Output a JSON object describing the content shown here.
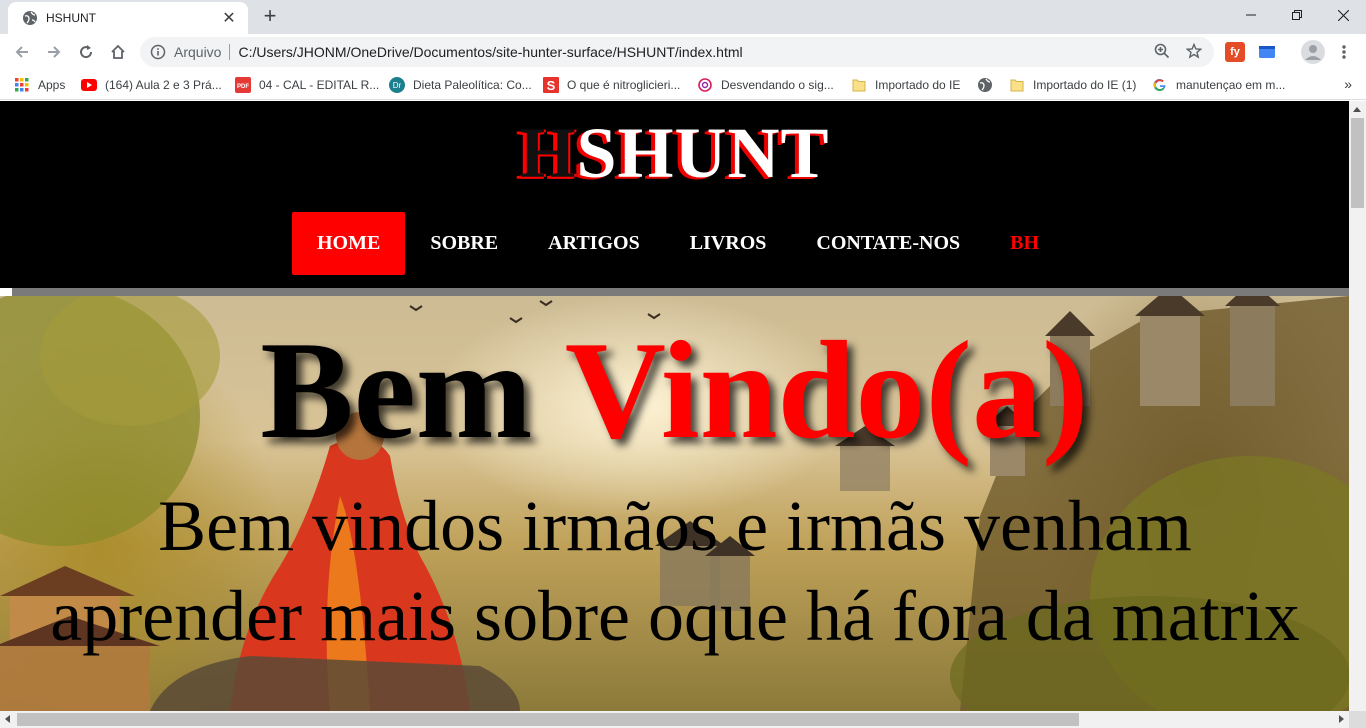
{
  "browser": {
    "tab_title": "HSHUNT",
    "new_tab_symbol": "+",
    "close_symbol": "✕",
    "omnibox_label": "Arquivo",
    "url": "C:/Users/JHONM/OneDrive/Documentos/site-hunter-surface/HSHUNT/index.html",
    "extension_fy_label": "fy",
    "bookmarks": [
      {
        "icon": "apps-grid-icon",
        "label": "Apps"
      },
      {
        "icon": "youtube-icon",
        "label": "(164) Aula 2 e 3 Prá..."
      },
      {
        "icon": "pdf-icon",
        "label": "04 - CAL - EDITAL R..."
      },
      {
        "icon": "dr-site-icon",
        "label": "Dieta Paleolítica: Co..."
      },
      {
        "icon": "s-site-icon",
        "label": "O que é nitroglicieri..."
      },
      {
        "icon": "swirl-site-icon",
        "label": "Desvendando o sig..."
      },
      {
        "icon": "folder-icon",
        "label": "Importado do IE"
      },
      {
        "icon": "globe-icon",
        "label": ""
      },
      {
        "icon": "folder-icon",
        "label": "Importado do IE (1)"
      },
      {
        "icon": "google-icon",
        "label": "manutençao em m..."
      }
    ],
    "bookmarks_more": "»"
  },
  "site": {
    "logo_first": "H",
    "logo_rest": "SHUNT",
    "nav": [
      {
        "label": "HOME",
        "state": "active"
      },
      {
        "label": "SOBRE",
        "state": "normal"
      },
      {
        "label": "ARTIGOS",
        "state": "normal"
      },
      {
        "label": "LIVROS",
        "state": "normal"
      },
      {
        "label": "CONTATE-NOS",
        "state": "normal"
      },
      {
        "label": "BH",
        "state": "red"
      }
    ],
    "hero": {
      "title_black": "Bem ",
      "title_red": "Vindo(a)",
      "text": "Bem vindos irmãos e irmãs venham aprender mais sobre oque há fora da matrix"
    }
  },
  "colors": {
    "accent_red": "#ff0000",
    "header_bg": "#000000",
    "chrome_tabstrip": "#dee1e6"
  }
}
